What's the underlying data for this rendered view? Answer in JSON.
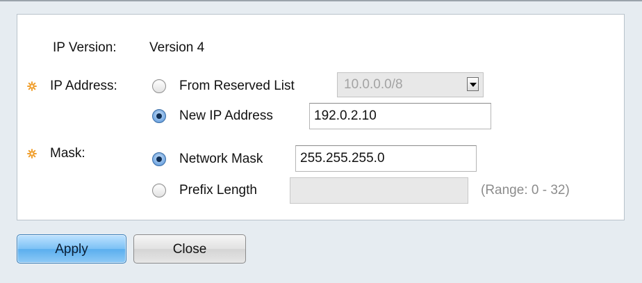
{
  "form": {
    "ip_version": {
      "label": "IP Version:",
      "value": "Version 4"
    },
    "ip_address": {
      "label": "IP Address:",
      "required": true,
      "options": [
        {
          "label": "From Reserved List",
          "selected": false,
          "select_value": "10.0.0.0/8",
          "disabled": true
        },
        {
          "label": "New IP Address",
          "selected": true,
          "input_value": "192.0.2.10"
        }
      ]
    },
    "mask": {
      "label": "Mask:",
      "required": true,
      "options": [
        {
          "label": "Network Mask",
          "selected": true,
          "input_value": "255.255.255.0"
        },
        {
          "label": "Prefix Length",
          "selected": false,
          "input_value": "",
          "disabled": true,
          "hint": "(Range: 0 - 32)"
        }
      ]
    }
  },
  "buttons": {
    "apply": "Apply",
    "close": "Close"
  },
  "colors": {
    "required_icon": "#f0a030",
    "apply_button": "#7cc1f5",
    "background": "#e6ecf1"
  }
}
